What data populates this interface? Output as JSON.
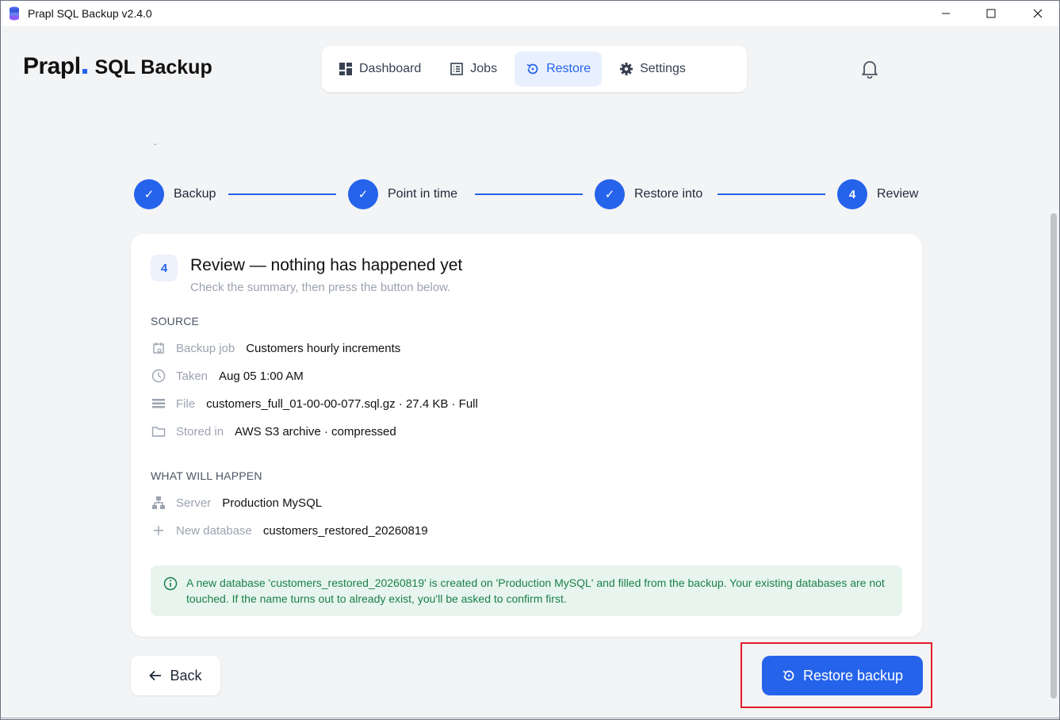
{
  "window": {
    "title": "Prapl SQL Backup v2.4.0"
  },
  "brand": {
    "logo": "Prapl",
    "product": "SQL Backup"
  },
  "nav": {
    "items": [
      {
        "label": "Dashboard",
        "icon": "dashboard-icon",
        "active": false
      },
      {
        "label": "Jobs",
        "icon": "jobs-icon",
        "active": false
      },
      {
        "label": "Restore",
        "icon": "restore-icon",
        "active": true
      },
      {
        "label": "Settings",
        "icon": "gear-icon",
        "active": false
      }
    ]
  },
  "stepper": {
    "steps": [
      {
        "label": "Backup",
        "state": "done",
        "marker": "✓"
      },
      {
        "label": "Point in time",
        "state": "done",
        "marker": "✓"
      },
      {
        "label": "Restore into",
        "state": "done",
        "marker": "✓"
      },
      {
        "label": "Review",
        "state": "current",
        "marker": "4"
      }
    ]
  },
  "card": {
    "step_number": "4",
    "title": "Review — nothing has happened yet",
    "subtitle": "Check the summary, then press the button below.",
    "source": {
      "heading": "SOURCE",
      "rows": [
        {
          "icon": "calendar-icon",
          "label": "Backup job",
          "value": "Customers hourly increments"
        },
        {
          "icon": "clock-icon",
          "label": "Taken",
          "value": "Aug 05 1:00 AM"
        },
        {
          "icon": "file-list-icon",
          "label": "File",
          "value": "customers_full_01-00-00-077.sql.gz · 27.4 KB · Full"
        },
        {
          "icon": "folder-icon",
          "label": "Stored in",
          "value": "AWS S3 archive · compressed"
        }
      ]
    },
    "what_will_happen": {
      "heading": "WHAT WILL HAPPEN",
      "rows": [
        {
          "icon": "server-icon",
          "label": "Server",
          "value": "Production MySQL"
        },
        {
          "icon": "plus-icon",
          "label": "New database",
          "value": "customers_restored_20260819"
        }
      ]
    },
    "notice": "A new database 'customers_restored_20260819' is created on 'Production MySQL' and filled from the backup. Your existing databases are not touched. If the name turns out to already exist, you'll be asked to confirm first."
  },
  "actions": {
    "back_label": "Back",
    "restore_label": "Restore backup"
  },
  "colors": {
    "accent": "#2563eb",
    "notice_bg": "#e8f5ee",
    "notice_text": "#1a7f4b",
    "highlight": "#e11d2a"
  }
}
